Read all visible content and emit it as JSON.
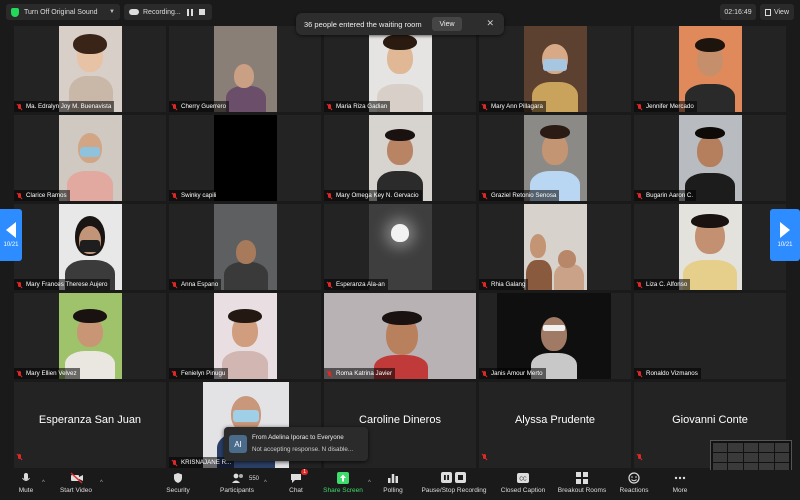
{
  "topbar": {
    "sound_label": "Turn Off Original Sound",
    "recording_label": "Recording...",
    "time": "02:16:49",
    "view_label": "View"
  },
  "notification": {
    "text": "36 people entered the waiting room",
    "view_button": "View"
  },
  "pager": {
    "left": "10/21",
    "right": "10/21"
  },
  "participants": [
    {
      "name": "Ma. Edralyn Joy M. Buenavista"
    },
    {
      "name": "Cherry Guerrero"
    },
    {
      "name": "Maria Riza Gadian"
    },
    {
      "name": "Mary Ann Pillagara"
    },
    {
      "name": "Jennifer Mercado"
    },
    {
      "name": "Clarice Ramos"
    },
    {
      "name": "Swinky capili"
    },
    {
      "name": "Mary Omega Key N. Gervacio"
    },
    {
      "name": "Graziel Retonio Senosa"
    },
    {
      "name": "Bugarin Aaron C."
    },
    {
      "name": "Mary Frances Therese Aujero"
    },
    {
      "name": "Anna Espano"
    },
    {
      "name": "Esperanza Ala-an"
    },
    {
      "name": "Rhia Galang"
    },
    {
      "name": "Liza C. Alfonso"
    },
    {
      "name": "Mary Ellien Velvez"
    },
    {
      "name": "Fenielyn Pinugu"
    },
    {
      "name": "Roma Katrina Javier"
    },
    {
      "name": "Janis Amour Merto"
    },
    {
      "name": "Ronaldo Vizmanos"
    },
    {
      "name": "Esperanza San Juan"
    },
    {
      "name": "KRISNAJANE R..."
    },
    {
      "name": "Caroline Dineros"
    },
    {
      "name": "Alyssa Prudente"
    },
    {
      "name": "Giovanni Conte"
    }
  ],
  "chat_popup": {
    "avatar": "AI",
    "from": "From Adelina Iporac to Everyone",
    "message": "Not accepting response. N disable..."
  },
  "toolbar": {
    "mute": "Mute",
    "start_video": "Start Video",
    "security": "Security",
    "participants": "Participants",
    "participants_count": "550",
    "chat": "Chat",
    "chat_badge": "1",
    "share_screen": "Share Screen",
    "polling": "Polling",
    "pause_stop_recording": "Pause/Stop Recording",
    "closed_caption": "Closed Caption",
    "breakout_rooms": "Breakout Rooms",
    "reactions": "Reactions",
    "more": "More"
  },
  "colors": {
    "accent": "#2d8cff",
    "share_green": "#3ddc6b",
    "muted_red": "#e02828"
  }
}
